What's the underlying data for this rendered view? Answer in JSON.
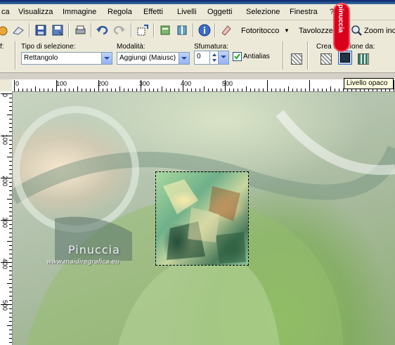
{
  "menu": [
    "ca",
    "Visualizza",
    "Immagine",
    "Regola",
    "Effetti",
    "Livelli",
    "Oggetti",
    "Selezione",
    "Finestra",
    "?"
  ],
  "toolbar": {
    "photo_retouch_label": "Fotoritocco",
    "palettes_label": "Tavolozze",
    "zoom_label": "Zoom ind"
  },
  "options": {
    "cut_label": "f:",
    "selection_type_label": "Tipo di selezione:",
    "selection_type_value": "Rettangolo",
    "mode_label": "Modalità:",
    "mode_value": "Aggiungi (Maiusc)",
    "feather_label": "Sfumatura:",
    "feather_value": "0",
    "antialias_label": "Antialias",
    "antialias_checked": true,
    "create_selection_label": "Crea selezione da:"
  },
  "tooltip": "Livello opaco",
  "badge": "pinuccia",
  "ruler_top": [
    "0",
    "100",
    "200",
    "300",
    "400",
    "500"
  ],
  "ruler_left": [
    "0",
    "100",
    "200",
    "300",
    "400",
    "500"
  ],
  "watermark": {
    "name": "Pinuccia",
    "url": "www.maidiregrafica.eu"
  },
  "colors": {
    "menu_bg": "#ece9d8",
    "badge": "#d8001a",
    "tooltip_bg": "#ffffe1"
  }
}
